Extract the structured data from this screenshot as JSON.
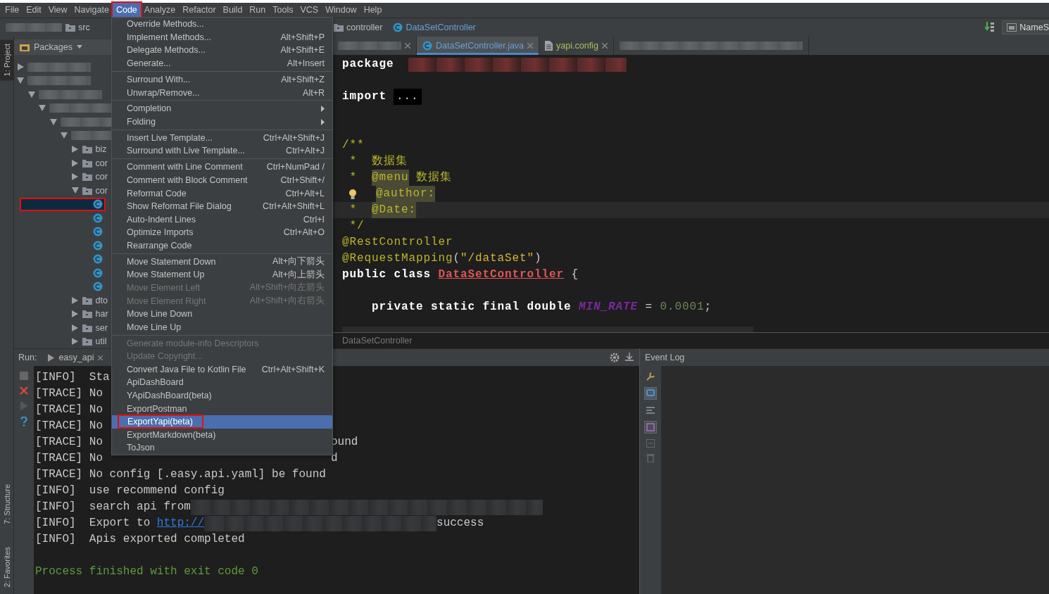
{
  "menubar": [
    {
      "label": "File",
      "selected": false
    },
    {
      "label": "Edit",
      "selected": false
    },
    {
      "label": "View",
      "selected": false
    },
    {
      "label": "Navigate",
      "selected": false
    },
    {
      "label": "Code",
      "selected": true,
      "highlighted": true
    },
    {
      "label": "Analyze",
      "selected": false
    },
    {
      "label": "Refactor",
      "selected": false
    },
    {
      "label": "Build",
      "selected": false
    },
    {
      "label": "Run",
      "selected": false
    },
    {
      "label": "Tools",
      "selected": false
    },
    {
      "label": "VCS",
      "selected": false
    },
    {
      "label": "Window",
      "selected": false
    },
    {
      "label": "Help",
      "selected": false
    }
  ],
  "navbar": {
    "left_crumbs": [
      {
        "kind": "redacted"
      },
      {
        "kind": "folder",
        "label": "src"
      }
    ],
    "crumbs": [
      {
        "kind": "folder",
        "label": "controller"
      },
      {
        "kind": "class",
        "label": "DataSetController"
      }
    ],
    "right_label": "NameS"
  },
  "tool_strip": {
    "top": [
      {
        "label": "1: Project",
        "selected": true
      }
    ],
    "bottom": [
      {
        "label": "7: Structure",
        "selected": false
      },
      {
        "label": "2: Favorites",
        "selected": false
      }
    ]
  },
  "project": {
    "title": "Packages",
    "tree": [
      {
        "kind": "redacted",
        "expanded": false
      },
      {
        "kind": "redacted",
        "expanded": true,
        "children": [
          {
            "kind": "redacted",
            "expanded": true,
            "children": [
              {
                "kind": "redacted",
                "expanded": true,
                "children": [
                  {
                    "kind": "redacted",
                    "expanded": true,
                    "children": [
                      {
                        "kind": "redacted",
                        "expanded": true,
                        "children": [
                          {
                            "kind": "package",
                            "label": "biz",
                            "expanded": false
                          },
                          {
                            "kind": "package",
                            "label": "cor",
                            "expanded": false
                          },
                          {
                            "kind": "package",
                            "label": "cor",
                            "expanded": false
                          },
                          {
                            "kind": "package",
                            "label": "cor",
                            "expanded": true,
                            "children": [
                              {
                                "kind": "class",
                                "selected": true,
                                "highlighted": true
                              },
                              {
                                "kind": "class",
                                "selected": false
                              },
                              {
                                "kind": "class",
                                "selected": false
                              },
                              {
                                "kind": "class",
                                "selected": false
                              },
                              {
                                "kind": "class",
                                "selected": false
                              },
                              {
                                "kind": "class",
                                "selected": false
                              },
                              {
                                "kind": "class",
                                "selected": false
                              }
                            ]
                          },
                          {
                            "kind": "package",
                            "label": "dto",
                            "expanded": false
                          },
                          {
                            "kind": "package",
                            "label": "har",
                            "expanded": false
                          },
                          {
                            "kind": "package",
                            "label": "ser",
                            "expanded": false
                          },
                          {
                            "kind": "package",
                            "label": "util",
                            "expanded": false
                          }
                        ]
                      }
                    ]
                  }
                ]
              }
            ]
          }
        ]
      }
    ]
  },
  "editor": {
    "tabs": [
      {
        "kind": "redacted",
        "selected": false
      },
      {
        "kind": "class",
        "label": "DataSetController.java",
        "selected": true,
        "color": "#6a9fd8"
      },
      {
        "kind": "file",
        "label": "yapi.config",
        "selected": false,
        "color": "#a5c25c"
      },
      {
        "kind": "redacted",
        "selected": false
      }
    ],
    "lines": [
      {
        "kind": "code",
        "current": false,
        "tokens": [
          {
            "kind": "keyword",
            "text": "package"
          },
          {
            "kind": "redacted"
          }
        ]
      },
      {
        "kind": "blank"
      },
      {
        "kind": "code",
        "current": false,
        "tokens": [
          {
            "kind": "keyword",
            "text": "import"
          },
          {
            "kind": "folded",
            "text": "..."
          }
        ]
      },
      {
        "kind": "blank"
      },
      {
        "kind": "blank"
      },
      {
        "kind": "code",
        "current": false,
        "tokens": [
          {
            "kind": "comment",
            "text": "/**"
          }
        ]
      },
      {
        "kind": "code",
        "current": false,
        "tokens": [
          {
            "kind": "comment",
            "text": " *  数据集"
          }
        ]
      },
      {
        "kind": "code",
        "current": false,
        "tokens": [
          {
            "kind": "comment",
            "text": " *  "
          },
          {
            "kind": "doctag",
            "text": "@menu"
          },
          {
            "kind": "comment",
            "text": " 数据集"
          }
        ]
      },
      {
        "kind": "code",
        "current": false,
        "tokens": [
          {
            "kind": "bulb"
          },
          {
            "kind": "doctag",
            "text": "@author:"
          }
        ]
      },
      {
        "kind": "code",
        "current": true,
        "tokens": [
          {
            "kind": "comment",
            "text": " *  "
          },
          {
            "kind": "doctag",
            "text": "@Date:"
          }
        ]
      },
      {
        "kind": "code",
        "current": false,
        "tokens": [
          {
            "kind": "comment",
            "text": " */"
          }
        ]
      },
      {
        "kind": "code",
        "current": false,
        "tokens": [
          {
            "kind": "annotation",
            "text": "@RestController"
          }
        ]
      },
      {
        "kind": "code",
        "current": false,
        "tokens": [
          {
            "kind": "annotation",
            "text": "@RequestMapping"
          },
          {
            "kind": "plain",
            "text": "("
          },
          {
            "kind": "string",
            "text": "\"/dataSet\""
          },
          {
            "kind": "plain",
            "text": ")"
          }
        ]
      },
      {
        "kind": "code",
        "current": false,
        "tokens": [
          {
            "kind": "keyword",
            "text": "public class "
          },
          {
            "kind": "classname",
            "text": "DataSetController"
          },
          {
            "kind": "plain",
            "text": " {"
          }
        ]
      },
      {
        "kind": "blank"
      },
      {
        "kind": "code",
        "current": false,
        "tokens": [
          {
            "kind": "keyword",
            "text": "    private static final double "
          },
          {
            "kind": "constant",
            "text": "MIN_RATE"
          },
          {
            "kind": "plain",
            "text": " = "
          },
          {
            "kind": "number",
            "text": "0.0001"
          },
          {
            "kind": "plain",
            "text": ";"
          }
        ]
      }
    ],
    "breadcrumb": "DataSetController"
  },
  "code_menu": [
    {
      "kind": "item",
      "label": "Override Methods...",
      "disabled": false,
      "selected": false
    },
    {
      "kind": "item",
      "label": "Implement Methods...",
      "shortcut": "Alt+Shift+P",
      "disabled": false,
      "selected": false
    },
    {
      "kind": "item",
      "label": "Delegate Methods...",
      "shortcut": "Alt+Shift+E",
      "disabled": false,
      "selected": false
    },
    {
      "kind": "item",
      "label": "Generate...",
      "shortcut": "Alt+Insert",
      "disabled": false,
      "selected": false
    },
    {
      "kind": "separator"
    },
    {
      "kind": "item",
      "label": "Surround With...",
      "shortcut": "Alt+Shift+Z",
      "disabled": false,
      "selected": false
    },
    {
      "kind": "item",
      "label": "Unwrap/Remove...",
      "shortcut": "Alt+R",
      "disabled": false,
      "selected": false
    },
    {
      "kind": "separator"
    },
    {
      "kind": "submenu",
      "label": "Completion",
      "disabled": false,
      "selected": false
    },
    {
      "kind": "submenu",
      "label": "Folding",
      "disabled": false,
      "selected": false
    },
    {
      "kind": "separator"
    },
    {
      "kind": "item",
      "label": "Insert Live Template...",
      "shortcut": "Ctrl+Alt+Shift+J",
      "disabled": false,
      "selected": false
    },
    {
      "kind": "item",
      "label": "Surround with Live Template...",
      "shortcut": "Ctrl+Alt+J",
      "disabled": false,
      "selected": false
    },
    {
      "kind": "separator"
    },
    {
      "kind": "item",
      "label": "Comment with Line Comment",
      "shortcut": "Ctrl+NumPad /",
      "disabled": false,
      "selected": false
    },
    {
      "kind": "item",
      "label": "Comment with Block Comment",
      "shortcut": "Ctrl+Shift+/",
      "disabled": false,
      "selected": false
    },
    {
      "kind": "item",
      "label": "Reformat Code",
      "shortcut": "Ctrl+Alt+L",
      "disabled": false,
      "selected": false
    },
    {
      "kind": "item",
      "label": "Show Reformat File Dialog",
      "shortcut": "Ctrl+Alt+Shift+L",
      "disabled": false,
      "selected": false
    },
    {
      "kind": "item",
      "label": "Auto-Indent Lines",
      "shortcut": "Ctrl+I",
      "disabled": false,
      "selected": false
    },
    {
      "kind": "item",
      "label": "Optimize Imports",
      "shortcut": "Ctrl+Alt+O",
      "disabled": false,
      "selected": false
    },
    {
      "kind": "item",
      "label": "Rearrange Code",
      "disabled": false,
      "selected": false
    },
    {
      "kind": "separator"
    },
    {
      "kind": "item",
      "label": "Move Statement Down",
      "shortcut": "Alt+向下箭头",
      "disabled": false,
      "selected": false
    },
    {
      "kind": "item",
      "label": "Move Statement Up",
      "shortcut": "Alt+向上箭头",
      "disabled": false,
      "selected": false
    },
    {
      "kind": "item",
      "label": "Move Element Left",
      "shortcut": "Alt+Shift+向左箭头",
      "disabled": true,
      "selected": false
    },
    {
      "kind": "item",
      "label": "Move Element Right",
      "shortcut": "Alt+Shift+向右箭头",
      "disabled": true,
      "selected": false
    },
    {
      "kind": "item",
      "label": "Move Line Down",
      "disabled": false,
      "selected": false
    },
    {
      "kind": "item",
      "label": "Move Line Up",
      "disabled": false,
      "selected": false
    },
    {
      "kind": "separator"
    },
    {
      "kind": "item",
      "label": "Generate module-info Descriptors",
      "disabled": true,
      "selected": false
    },
    {
      "kind": "item",
      "label": "Update Copyright...",
      "disabled": true,
      "selected": false
    },
    {
      "kind": "item",
      "label": "Convert Java File to Kotlin File",
      "shortcut": "Ctrl+Alt+Shift+K",
      "disabled": false,
      "selected": false
    },
    {
      "kind": "item",
      "label": "ApiDashBoard",
      "disabled": false,
      "selected": false
    },
    {
      "kind": "item",
      "label": "YApiDashBoard(beta)",
      "disabled": false,
      "selected": false
    },
    {
      "kind": "item",
      "label": "ExportPostman",
      "disabled": false,
      "selected": false
    },
    {
      "kind": "item",
      "label": "ExportYapi(beta)",
      "disabled": false,
      "selected": true,
      "highlighted": true
    },
    {
      "kind": "item",
      "label": "ExportMarkdown(beta)",
      "disabled": false,
      "selected": false
    },
    {
      "kind": "item",
      "label": "ToJson",
      "disabled": false,
      "selected": false
    }
  ],
  "run": {
    "label": "Run:",
    "tab": "easy_api",
    "lines": [
      {
        "segments": [
          {
            "kind": "plain",
            "text": "[INFO]  Sta"
          }
        ]
      },
      {
        "segments": [
          {
            "kind": "plain",
            "text": "[TRACE] No"
          }
        ]
      },
      {
        "segments": [
          {
            "kind": "plain",
            "text": "[TRACE] No"
          }
        ]
      },
      {
        "segments": [
          {
            "kind": "plain",
            "text": "[TRACE] No"
          }
        ]
      },
      {
        "segments": [
          {
            "kind": "plain",
            "text": "[TRACE] No"
          }
        ],
        "tail": [
          {
            "kind": "plain",
            "text": "ound"
          }
        ]
      },
      {
        "segments": [
          {
            "kind": "plain",
            "text": "[TRACE] No"
          }
        ],
        "tail": [
          {
            "kind": "plain",
            "text": "d"
          }
        ]
      },
      {
        "segments": [
          {
            "kind": "plain",
            "text": "[TRACE] No config [.easy.api.yaml] be found"
          }
        ]
      },
      {
        "segments": [
          {
            "kind": "plain",
            "text": "[INFO]  use recommend config"
          }
        ]
      },
      {
        "segments": [
          {
            "kind": "plain",
            "text": "[INFO]  search api from"
          },
          {
            "kind": "redacted"
          }
        ]
      },
      {
        "segments": [
          {
            "kind": "plain",
            "text": "[INFO]  Export to "
          },
          {
            "kind": "link",
            "text": "http://"
          },
          {
            "kind": "redacted"
          },
          {
            "kind": "plain",
            "text": "success"
          }
        ]
      },
      {
        "segments": [
          {
            "kind": "plain",
            "text": "[INFO]  Apis exported completed"
          }
        ]
      },
      {
        "segments": [
          {
            "kind": "success",
            "text": "Process finished with exit code 0"
          }
        ]
      }
    ]
  },
  "event_log": {
    "title": "Event Log"
  }
}
